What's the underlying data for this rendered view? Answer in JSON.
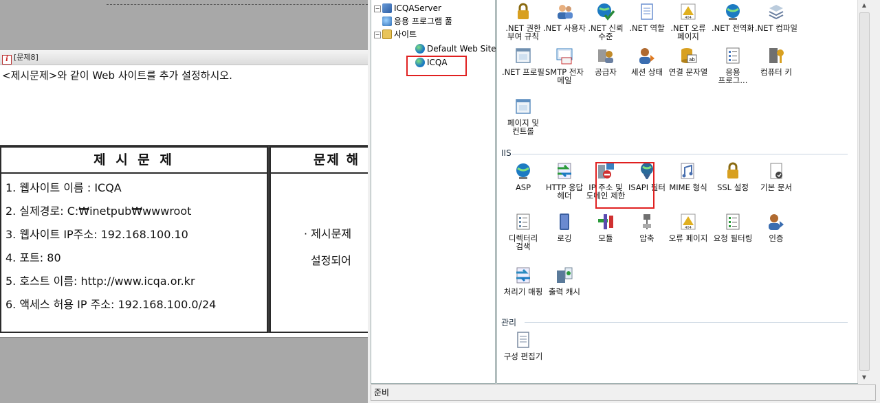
{
  "question": {
    "number_label": "[문제8]",
    "instruction": "<제시문제>와 같이 Web 사이트를 추가 설정하시오.",
    "table_left_header": "제 시 문 제",
    "table_right_header": "문제 해",
    "items": [
      "1. 웹사이트 이름 : ICQA",
      "2. 실제경로: C:₩inetpub₩wwwroot",
      "3. 웹사이트 IP주소: 192.168.100.10",
      "4. 포트: 80",
      "5. 호스트 이름: http://www.icqa.or.kr",
      "6. 액세스 허용 IP 주소: 192.168.100.0/24"
    ],
    "right_lines": [
      "· 제시문제",
      "설정되어"
    ]
  },
  "tree": {
    "server": "ICQAServer",
    "app_pools": "응용 프로그램 풀",
    "sites": "사이트",
    "default_site": "Default Web Site",
    "icqa_site": "ICQA"
  },
  "sections": {
    "iis": "IIS",
    "management": "관리"
  },
  "features": {
    "net_auth": [
      ".NET 권한",
      "부여 규칙"
    ],
    "net_users": [
      ".NET 사용자"
    ],
    "net_trust": [
      ".NET 신뢰",
      "수준"
    ],
    "net_roles": [
      ".NET 역할"
    ],
    "net_error": [
      ".NET 오류",
      "페이지"
    ],
    "net_global": [
      ".NET 전역화"
    ],
    "net_compile": [
      ".NET 컴파일"
    ],
    "net_profile": [
      ".NET 프로필"
    ],
    "smtp": [
      "SMTP 전자",
      "메일"
    ],
    "providers": [
      "공급자"
    ],
    "session": [
      "세션 상태"
    ],
    "connstr": [
      "연결 문자열"
    ],
    "app_settings": [
      "응용",
      "프로그..."
    ],
    "machine_key": [
      "컴퓨터 키"
    ],
    "pages_controls": [
      "페이지 및",
      "컨트롤"
    ],
    "asp": [
      "ASP"
    ],
    "http_headers": [
      "HTTP 응답",
      "헤더"
    ],
    "ip_domain": [
      "IP 주소 및",
      "도메인 제한"
    ],
    "isapi": [
      "ISAPI 필터"
    ],
    "mime": [
      "MIME 형식"
    ],
    "ssl": [
      "SSL 설정"
    ],
    "default_doc": [
      "기본 문서"
    ],
    "dir_browse": [
      "디렉터리",
      "검색"
    ],
    "logging": [
      "로깅"
    ],
    "modules": [
      "모듈"
    ],
    "compression": [
      "압축"
    ],
    "error_pages": [
      "오류 페이지"
    ],
    "req_filter": [
      "요청 필터링"
    ],
    "authentication": [
      "인증"
    ],
    "handler": [
      "처리기 매핑"
    ],
    "output_cache": [
      "출력 캐시"
    ],
    "config_editor": [
      "구성 편집기"
    ]
  },
  "status": "준비",
  "icons": {
    "app_pools": "app-pool-icon",
    "sites": "sites-folder-icon",
    "globe": "globe-icon"
  }
}
